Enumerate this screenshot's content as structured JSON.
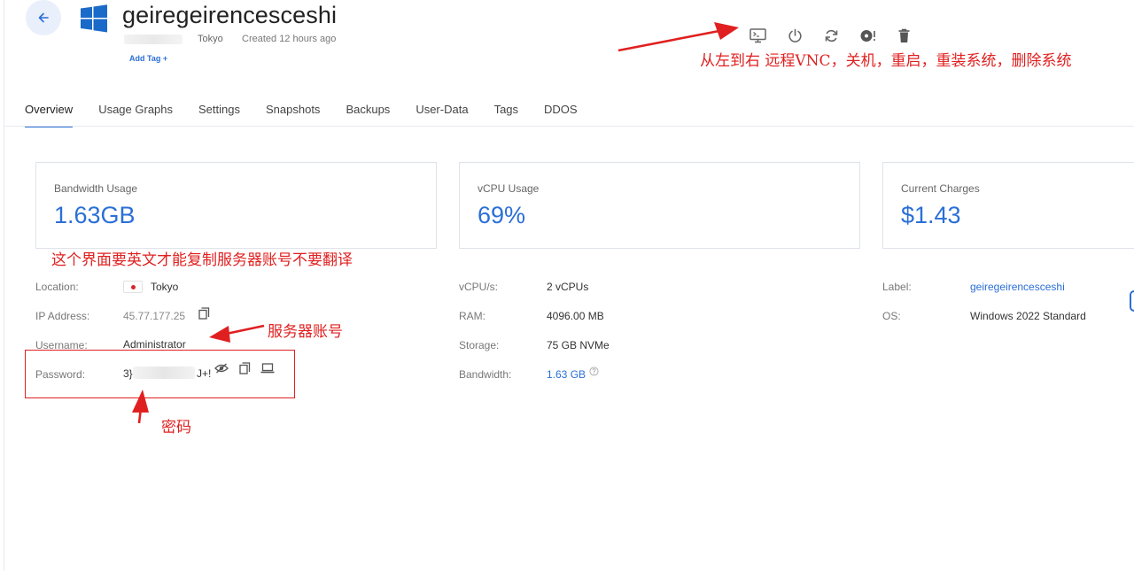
{
  "header": {
    "title": "geiregeirencesceshi",
    "location": "Tokyo",
    "created": "Created 12 hours ago",
    "add_tag": "Add Tag +"
  },
  "toolbar": [
    {
      "name": "remote-vnc-icon"
    },
    {
      "name": "power-icon"
    },
    {
      "name": "restart-icon"
    },
    {
      "name": "reinstall-icon"
    },
    {
      "name": "trash-icon"
    }
  ],
  "tabs": [
    {
      "label": "Overview",
      "active": true
    },
    {
      "label": "Usage Graphs"
    },
    {
      "label": "Settings"
    },
    {
      "label": "Snapshots"
    },
    {
      "label": "Backups"
    },
    {
      "label": "User-Data"
    },
    {
      "label": "Tags"
    },
    {
      "label": "DDOS"
    }
  ],
  "cards": {
    "bandwidth": {
      "label": "Bandwidth Usage",
      "value": "1.63GB"
    },
    "vcpu": {
      "label": "vCPU Usage",
      "value": "69%"
    },
    "charges": {
      "label": "Current Charges",
      "value": "$1.43"
    }
  },
  "details": {
    "location_label": "Location:",
    "location_value": "Tokyo",
    "ip_label": "IP Address:",
    "ip_value": "45.77.177.25",
    "username_label": "Username:",
    "username_value": "Administrator",
    "password_label": "Password:",
    "password_start": "3}",
    "password_end": "J+!",
    "vcpus_label": "vCPU/s:",
    "vcpus_value": "2 vCPUs",
    "ram_label": "RAM:",
    "ram_value": "4096.00 MB",
    "storage_label": "Storage:",
    "storage_value": "75 GB NVMe",
    "bandwidth_label": "Bandwidth:",
    "bandwidth_value": "1.63 GB",
    "label_label": "Label:",
    "label_value": "geiregeirencesceshi",
    "os_label": "OS:",
    "os_value": "Windows 2022 Standard"
  },
  "annotations": {
    "toolbar_note": "从左到右 远程VNC，关机，重启，重装系统，删除系统",
    "english_note": "这个界面要英文才能复制服务器账号不要翻译",
    "account_note": "服务器账号",
    "password_note": "密码"
  },
  "colors": {
    "accent": "#2a6fd6",
    "annotation": "#e02020",
    "windows_logo": "#1a6ac9"
  }
}
